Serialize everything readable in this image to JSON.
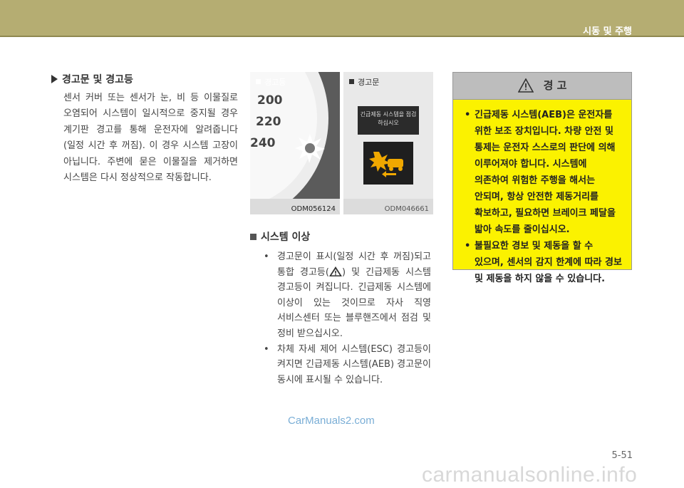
{
  "header": {
    "chapter": "시동 및 주행"
  },
  "left": {
    "title": "경고문 및 경고등",
    "body": "센서 커버 또는 센서가 눈, 비 등 이물질로 오염되어 시스템이 일시적으로 중지될 경우 계기판 경고를 통해 운전자에 알려줍니다(일정 시간 후 꺼짐). 이 경우 시스템 고장이 아닙니다. 주변에 묻은 이물질을 제거하면 시스템은 다시 정상적으로 작동합니다."
  },
  "image1": {
    "label": "경고등",
    "code": "ODM056124",
    "gauge": [
      "200",
      "220",
      "240"
    ]
  },
  "image2": {
    "label": "경고문",
    "message": "긴급제동 시스템을 점검하십시오",
    "code": "ODM046661"
  },
  "section": {
    "title": "시스템 이상",
    "bullet1_a": "경고문이 표시(일정 시간 후 꺼짐)되고 통합 경고등(",
    "bullet1_b": ") 및 긴급제동 시스템 경고등이 켜집니다. 긴급제동 시스템에 이상이 있는 것이므로 자사 직영 서비스센터 또는 블루핸즈에서 점검 및 정비 받으십시오.",
    "bullet2": "차체 자세 제어 시스템(ESC) 경고등이 켜지면 긴급제동 시스템(AEB) 경고문이 동시에 표시될 수 있습니다."
  },
  "warning": {
    "heading": "경    고",
    "items": [
      "긴급제동 시스템(AEB)은 운전자를 위한 보조 장치입니다. 차량 안전 및 통제는 운전자 스스로의 판단에 의해 이루어져야 합니다. 시스템에 의존하여 위험한 주행을 해서는 안되며, 항상 안전한 제동거리를 확보하고, 필요하면 브레이크 페달을 밟아 속도를 줄이십시오.",
      "불필요한 경보 및 제동을 할 수 있으며, 센서의 감지 한계에 따라 경보 및 제동을 하지 않을 수 있습니다."
    ]
  },
  "footer": {
    "page": "5-51",
    "watermark": "CarManuals2.com",
    "site": "carmanualsonline.info"
  }
}
